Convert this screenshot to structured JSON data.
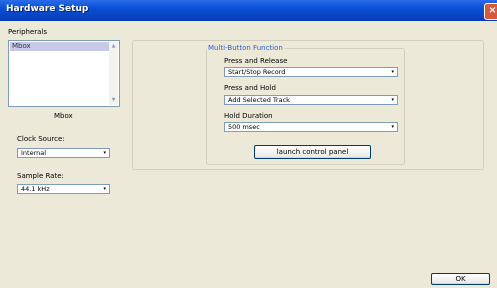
{
  "window": {
    "title": "Hardware Setup",
    "close_label": "×"
  },
  "peripherals": {
    "label": "Peripherals",
    "items": [
      "Mbox"
    ],
    "selected_caption": "Mbox"
  },
  "clock_source": {
    "label": "Clock Source:",
    "value": "Internal"
  },
  "sample_rate": {
    "label": "Sample Rate:",
    "value": "44.1 kHz"
  },
  "multi_button": {
    "title": "Multi-Button Function",
    "press_release": {
      "label": "Press and Release",
      "value": "Start/Stop Record"
    },
    "press_hold": {
      "label": "Press and Hold",
      "value": "Add Selected Track"
    },
    "hold_duration": {
      "label": "Hold Duration",
      "value": "500 msec"
    },
    "launch_button": "launch control panel"
  },
  "ok_button": "OK",
  "icons": {
    "dropdown": "▾",
    "scroll_up": "▲",
    "scroll_down": "▼"
  }
}
